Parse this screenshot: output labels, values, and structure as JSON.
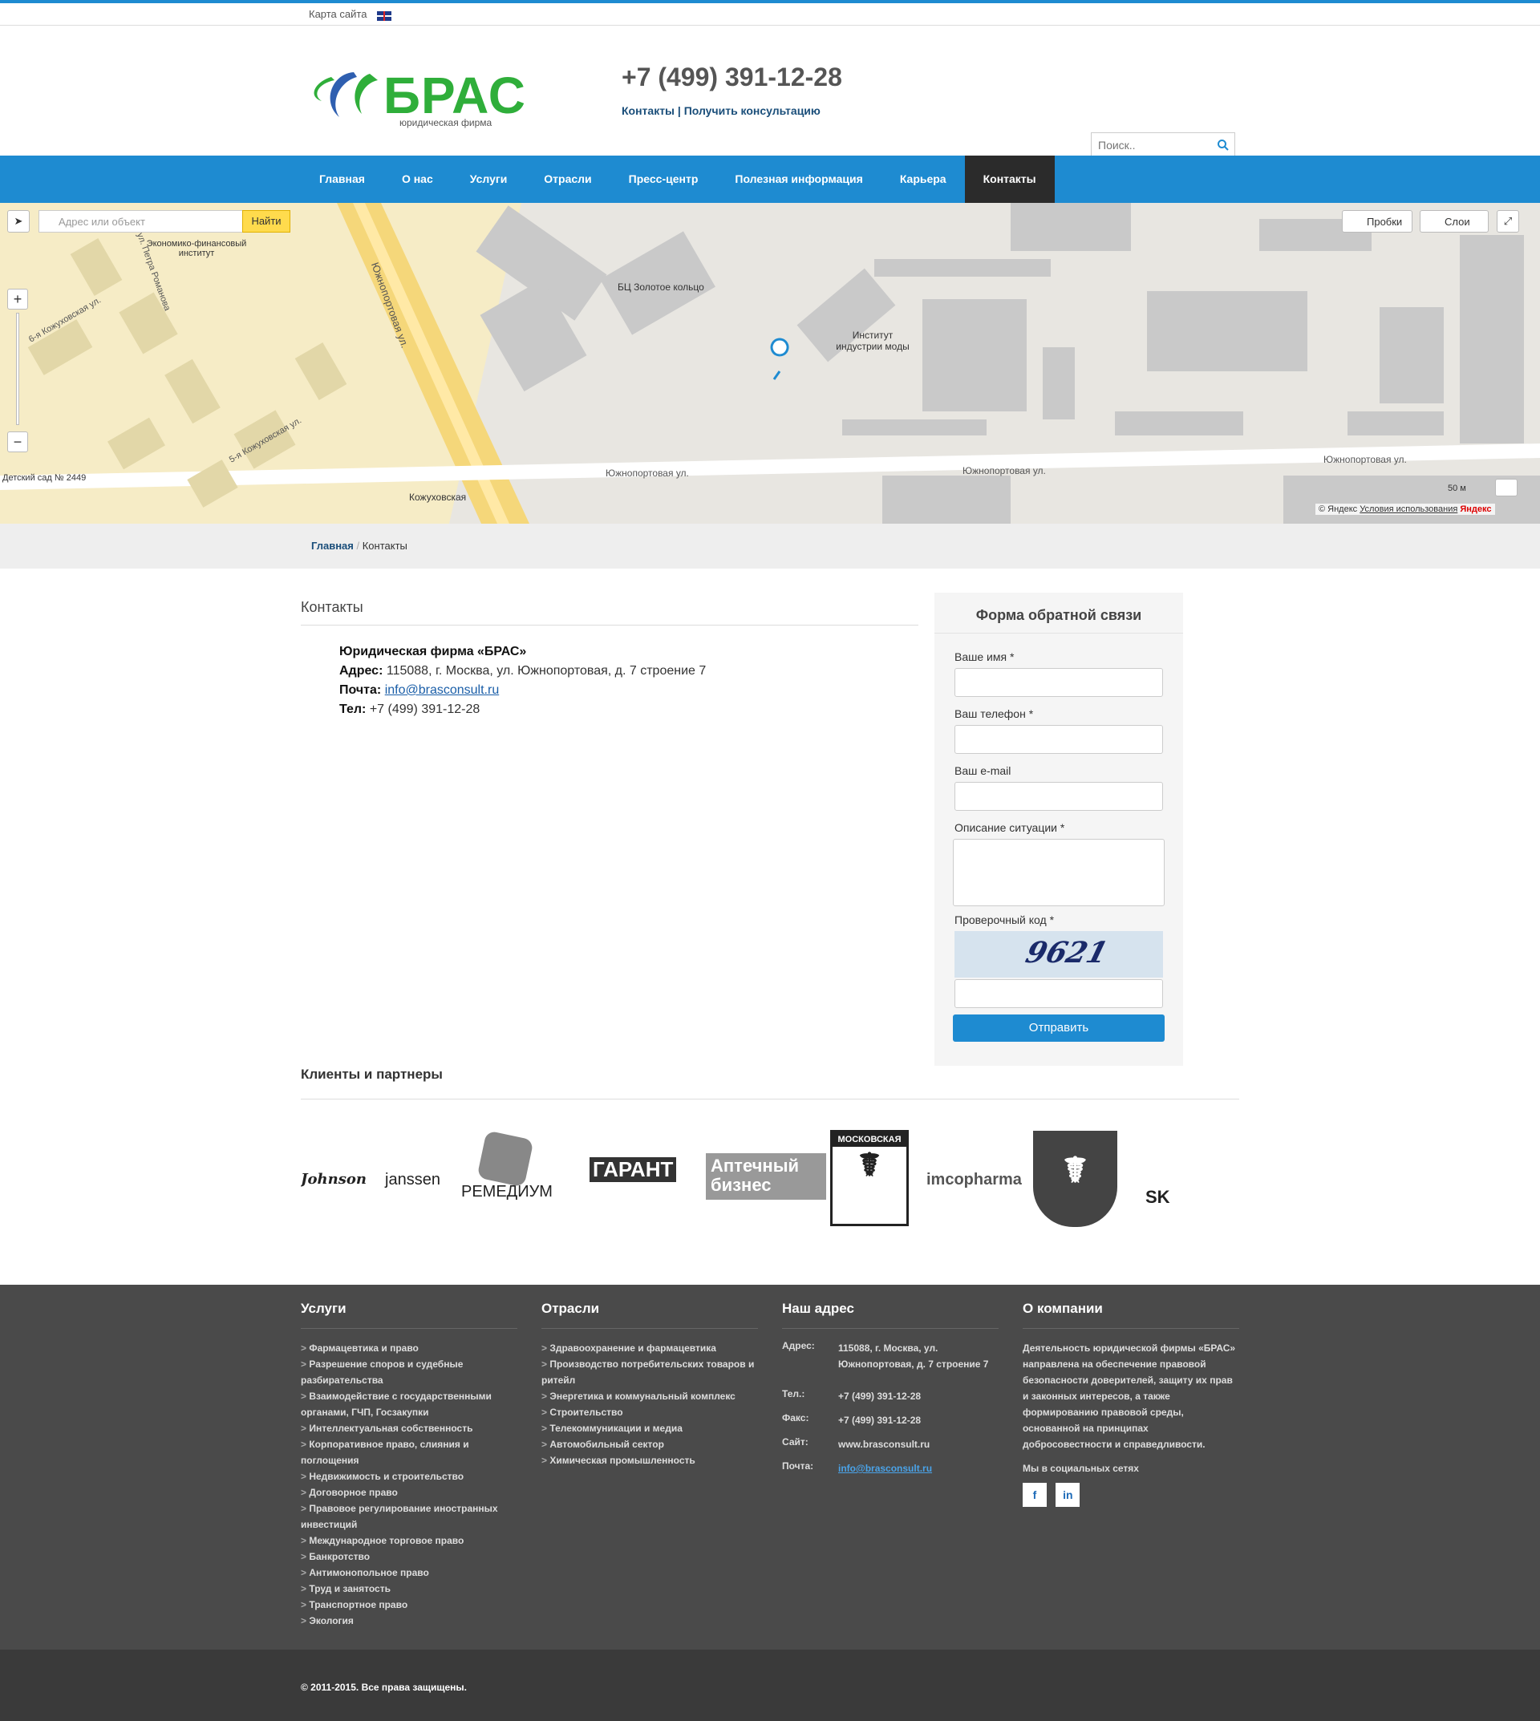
{
  "topbar": {
    "sitemap": "Карта сайта",
    "lang_icon": "uk-flag-icon"
  },
  "header": {
    "logo_name": "БРАС",
    "logo_sub": "юридическая фирма",
    "phone": "+7 (499) 391-12-28",
    "links": "Контакты | Получить консультацию",
    "search_placeholder": "Поиск.."
  },
  "nav": {
    "items": [
      "Главная",
      "О нас",
      "Услуги",
      "Отрасли",
      "Пресс-центр",
      "Полезная информация",
      "Карьера",
      "Контакты"
    ],
    "active": "Контакты"
  },
  "map": {
    "search_placeholder": "Адрес или объект",
    "search_button": "Найти",
    "traffic": "Пробки",
    "layers": "Слои",
    "scale": "50 м",
    "copyright": "© Яндекс",
    "terms": "Условия использования",
    "brand": "Яндекс",
    "labels": [
      "Южнопортовая ул.",
      "Южнопортовая ул.",
      "Южнопортовая ул.",
      "Южнопортовая ул.",
      "Кожуховская",
      "БЦ Золотое кольцо",
      "Институт индустрии моды",
      "Экономико-финансовый институт",
      "Детский сад № 2449",
      "5-я Кожуховская ул.",
      "6-я Кожуховская ул.",
      "ул. Петра Романова"
    ]
  },
  "breadcrumb": {
    "home": "Главная",
    "current": "Контакты"
  },
  "contacts": {
    "title": "Контакты",
    "company": "Юридическая фирма «БРАС»",
    "address_label": "Адрес:",
    "address": "115088, г. Москва, ул. Южнопортовая, д. 7 строение 7",
    "mail_label": "Почта:",
    "mail": "info@brasconsult.ru",
    "phone_label": "Тел:",
    "phone": "+7 (499) 391-12-28"
  },
  "form": {
    "title": "Форма обратной связи",
    "name_label": "Ваше имя *",
    "phone_label": "Ваш телефон *",
    "email_label": "Ваш e-mail",
    "desc_label": "Описание ситуации *",
    "captcha_label": "Проверочный код *",
    "captcha_text": "9621",
    "submit": "Отправить"
  },
  "clients": {
    "title": "Клиенты и партнеры",
    "logos": [
      "Johnson",
      "janssen",
      "РЕМЕДИУМ",
      "ГАРАНТ",
      "Аптечный бизнес",
      "МОСКОВСКАЯ",
      "imcopharma",
      "SK"
    ]
  },
  "footer": {
    "services": {
      "title": "Услуги",
      "items": [
        "Фармацевтика и право",
        "Разрешение споров и судебные разбирательства",
        "Взаимодействие с государственными органами, ГЧП, Госзакупки",
        "Интеллектуальная собственность",
        "Корпоративное право, слияния и поглощения",
        "Недвижимость и строительство",
        "Договорное право",
        "Правовое регулирование иностранных инвестиций",
        "Международное торговое право",
        "Банкротство",
        "Антимонопольное право",
        "Труд и занятость",
        "Транспортное право",
        "Экология"
      ]
    },
    "industries": {
      "title": "Отрасли",
      "items": [
        "Здравоохранение и фармацевтика",
        "Производство потребительских товаров и ритейл",
        "Энергетика и коммунальный комплекс",
        "Строительство",
        "Телекоммуникации и медиа",
        "Автомобильный сектор",
        "Химическая промышленность"
      ]
    },
    "address": {
      "title": "Наш адрес",
      "addr_k": "Адрес:",
      "addr_v": "115088, г. Москва, ул. Южнопортовая, д. 7 строение 7",
      "tel_k": "Тел.:",
      "tel_v": "+7 (499) 391-12-28",
      "fax_k": "Факс:",
      "fax_v": "+7 (499) 391-12-28",
      "site_k": "Сайт:",
      "site_v": "www.brasconsult.ru",
      "mail_k": "Почта:",
      "mail_v": "info@brasconsult.ru"
    },
    "about": {
      "title": "О компании",
      "text": "Деятельность юридической фирмы «БРАС» направлена на обеспечение правовой безопасности доверителей, защиту их прав и законных интересов, а также формированию правовой среды, основанной на принципах добросовестности и справедливости.",
      "social_title": "Мы в социальных сетях",
      "fb": "f",
      "in": "in"
    },
    "copyright": "© 2011-2015. Все права защищены."
  },
  "colors": {
    "accent": "#1e8bd1",
    "dark_nav": "#2b2b2b",
    "brand_green": "#2fae3a",
    "footer": "#4a4a4a"
  }
}
